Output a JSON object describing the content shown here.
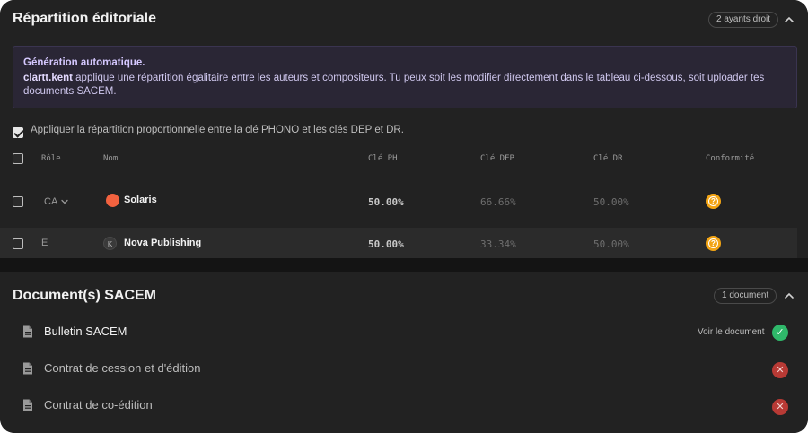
{
  "repartition": {
    "title": "Répartition éditoriale",
    "badge": "2 ayants droit",
    "info": {
      "heading": "Génération automatique.",
      "user": "clartt.kent",
      "message": " applique une répartition égalitaire entre les auteurs et compositeurs. Tu peux soit les modifier directement dans le tableau ci-dessous, soit uploader tes documents SACEM."
    },
    "proportional_label": "Appliquer la répartition proportionnelle entre la clé PHONO et les clés DEP et DR.",
    "columns": {
      "role": "Rôle",
      "name": "Nom",
      "ph": "Clé PH",
      "dep": "Clé DEP",
      "dr": "Clé DR",
      "conformity": "Conformité"
    },
    "rows": [
      {
        "role": "CA",
        "avatar": "",
        "avatar_color": "#f2623f",
        "name": "Solaris",
        "ph": "50.00%",
        "dep": "66.66%",
        "dr": "50.00%",
        "conformity": "?"
      },
      {
        "role": "E",
        "avatar": "K",
        "avatar_color": "#3a3a3a",
        "name": "Nova Publishing",
        "ph": "50.00%",
        "dep": "33.34%",
        "dr": "50.00%",
        "conformity": "?"
      }
    ]
  },
  "documents": {
    "title": "Document(s) SACEM",
    "badge": "1 document",
    "items": [
      {
        "name": "Bulletin SACEM",
        "status": "ok",
        "action": "Voir le document"
      },
      {
        "name": "Contrat de cession et d'édition",
        "status": "ko"
      },
      {
        "name": "Contrat de co-édition",
        "status": "ko"
      }
    ]
  },
  "colors": {
    "accent_purple": "#d5c8ff",
    "warning": "#f2a414",
    "success": "#2fb86a",
    "error": "#b83a35"
  }
}
